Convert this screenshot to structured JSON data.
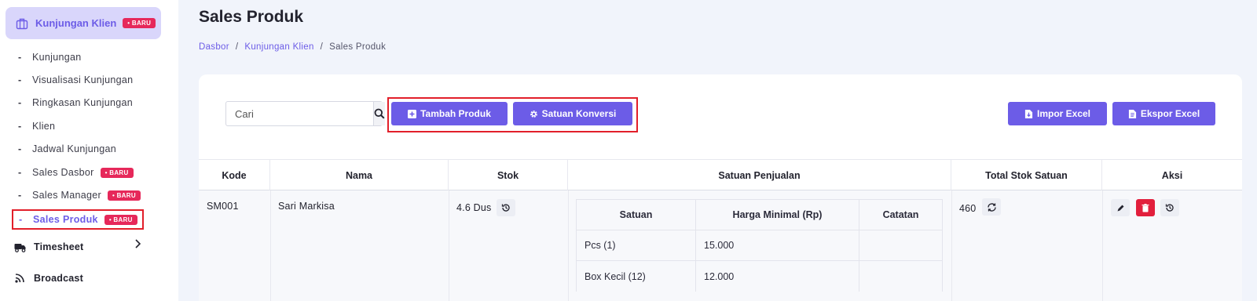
{
  "sidebar": {
    "active_menu": {
      "label": "Kunjungan Klien",
      "badge": "• BARU",
      "icon": "briefcase-icon"
    },
    "sub_items": [
      {
        "label": "Kunjungan"
      },
      {
        "label": "Visualisasi Kunjungan"
      },
      {
        "label": "Ringkasan Kunjungan"
      },
      {
        "label": "Klien"
      },
      {
        "label": "Jadwal Kunjungan"
      },
      {
        "label": "Sales Dasbor",
        "badge": "• BARU"
      },
      {
        "label": "Sales Manager",
        "badge": "• BARU"
      },
      {
        "label": "Sales Produk",
        "badge": "• BARU",
        "active": true
      }
    ],
    "groups": [
      {
        "label": "Timesheet",
        "icon": "truck-clock-icon"
      },
      {
        "label": "Broadcast",
        "icon": "broadcast-icon"
      }
    ]
  },
  "page": {
    "title": "Sales Produk",
    "breadcrumb": [
      "Dasbor",
      "Kunjungan Klien",
      "Sales Produk"
    ]
  },
  "toolbar": {
    "search_placeholder": "Cari",
    "add_product": "Tambah Produk",
    "unit_conversion": "Satuan Konversi",
    "import_excel": "Impor Excel",
    "export_excel": "Ekspor Excel"
  },
  "table": {
    "headers": [
      "Kode",
      "Nama",
      "Stok",
      "Satuan Penjualan",
      "Total Stok Satuan",
      "Aksi"
    ],
    "rows": [
      {
        "kode": "SM001",
        "nama": "Sari Markisa",
        "stok": "4.6 Dus",
        "total_stok": "460",
        "satuan_headers": [
          "Satuan",
          "Harga Minimal (Rp)",
          "Catatan"
        ],
        "satuan": [
          {
            "satuan": "Pcs (1)",
            "harga": "15.000",
            "catatan": ""
          },
          {
            "satuan": "Box Kecil (12)",
            "harga": "12.000",
            "catatan": ""
          }
        ]
      }
    ]
  },
  "colors": {
    "accent": "#6c5ce7",
    "badge": "#e6285a",
    "danger": "#e21f3c",
    "highlight": "#e21f2a"
  }
}
